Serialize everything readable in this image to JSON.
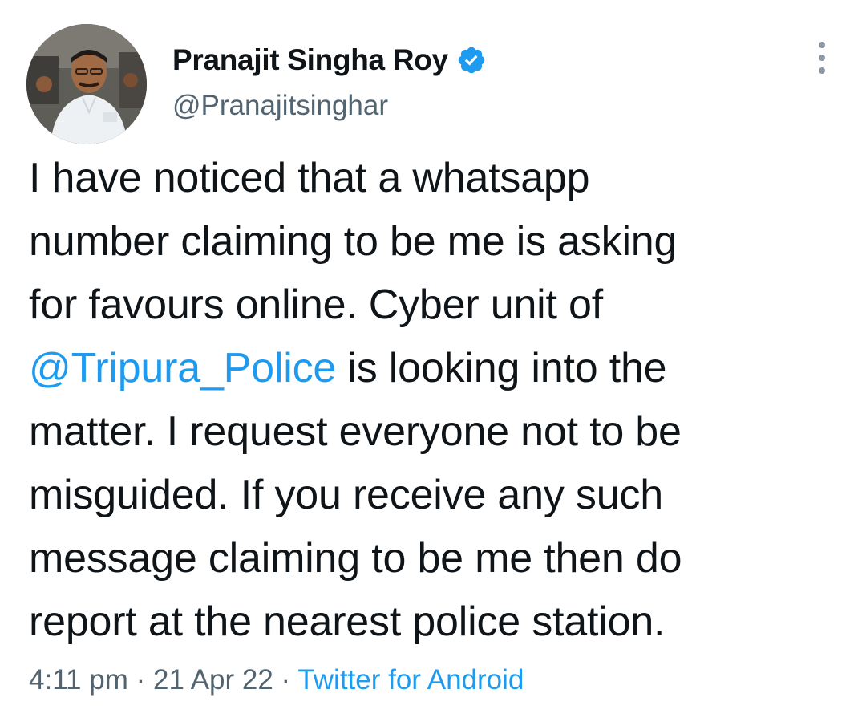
{
  "author": {
    "display_name": "Pranajit Singha Roy",
    "handle": "@Pranajitsinghar",
    "verified": true,
    "verified_icon": "verified-badge-icon",
    "avatar_icon": "profile-photo"
  },
  "menu": {
    "icon": "more-options-icon"
  },
  "tweet": {
    "lines": [
      {
        "text": "I have noticed that a whatsapp"
      },
      {
        "text": "number claiming to be me is asking"
      },
      {
        "text": "for favours online. Cyber unit of"
      },
      {
        "mention": "@Tripura_Police",
        "text": " is looking into the"
      },
      {
        "text": "matter. I request everyone not to be"
      },
      {
        "text": "misguided. If you receive any such"
      },
      {
        "text": "message claiming to be me then do"
      },
      {
        "text": "report at the nearest police station."
      }
    ]
  },
  "meta": {
    "time": "4:11 pm",
    "separator": " · ",
    "date": "21 Apr 22",
    "source": "Twitter for Android"
  },
  "colors": {
    "link": "#1d9bf0",
    "secondary": "#536471",
    "text": "#0f1419",
    "verified": "#1d9bf0"
  }
}
